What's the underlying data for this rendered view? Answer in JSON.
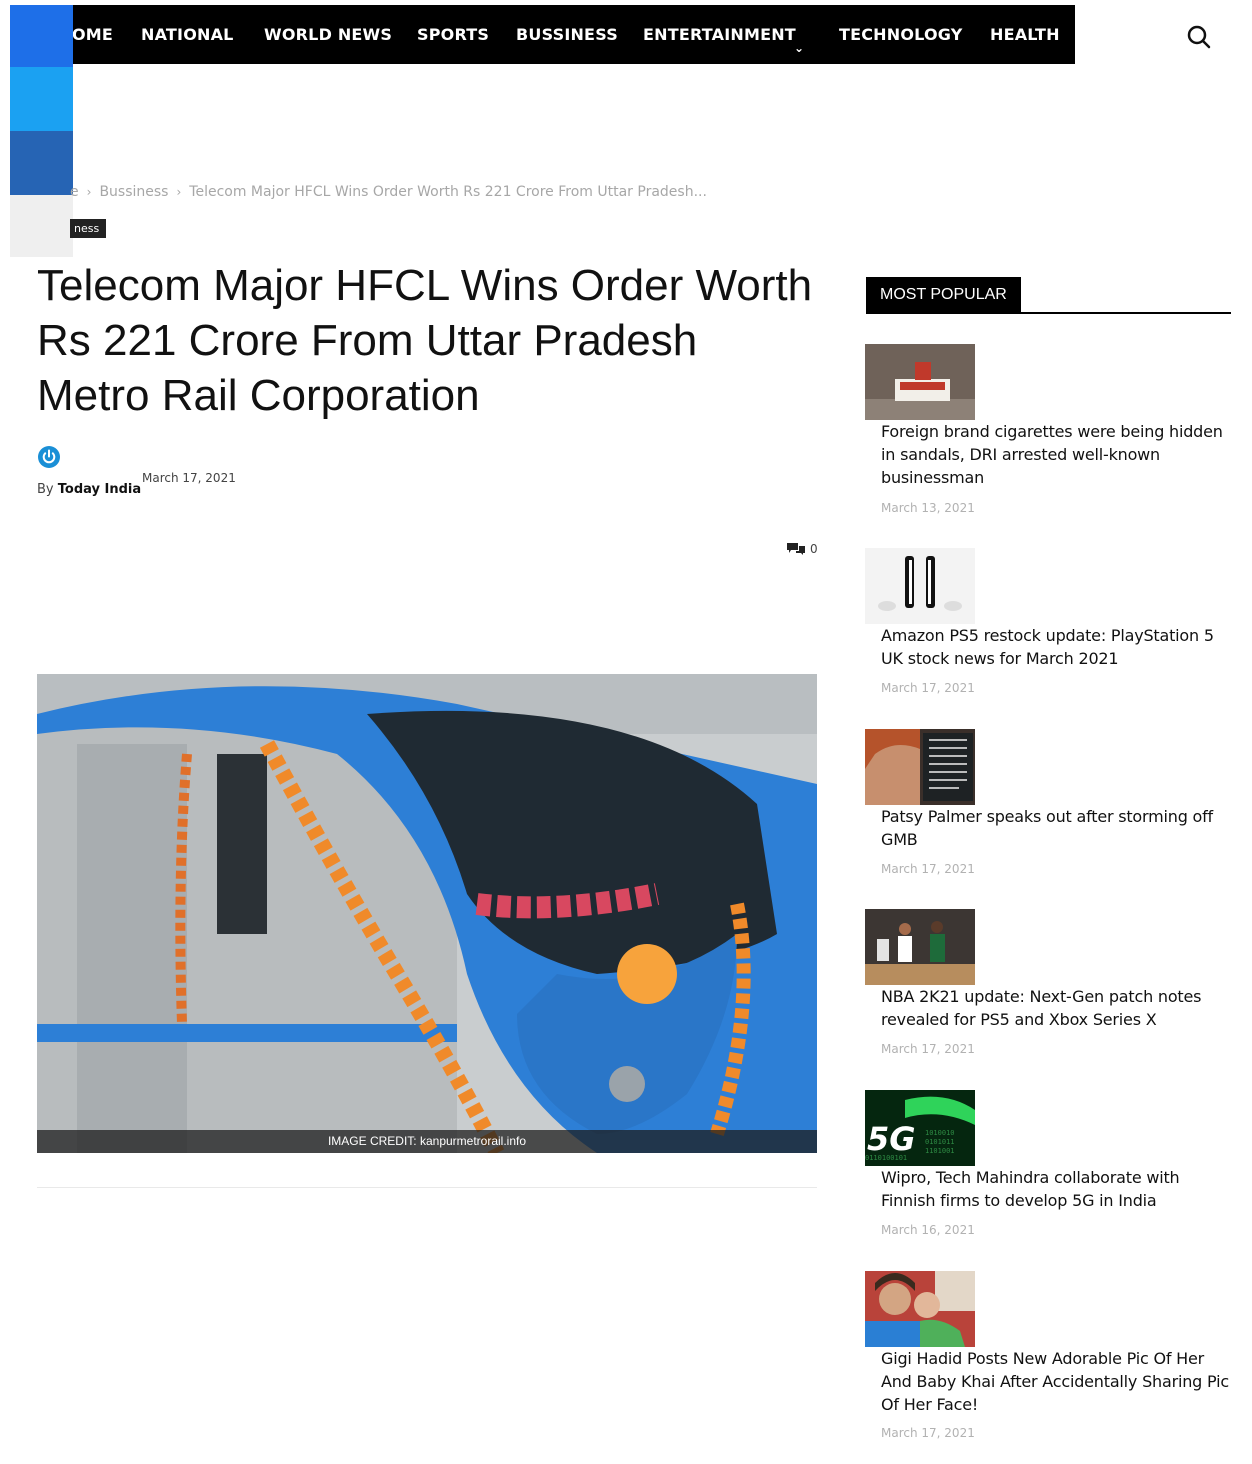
{
  "nav": {
    "items": [
      "OME",
      "NATIONAL",
      "WORLD NEWS",
      "SPORTS",
      "BUSSINESS",
      "ENTERTAINMENT",
      "TECHNOLOGY",
      "HEALTH"
    ]
  },
  "breadcrumb": {
    "home": "e",
    "category": "Bussiness",
    "current": "Telecom Major HFCL Wins Order Worth Rs 221 Crore From Uttar Pradesh..."
  },
  "category_badge": "ness",
  "article": {
    "title": "Telecom Major HFCL Wins Order Worth Rs 221 Crore From Uttar Pradesh Metro Rail Corporation",
    "by_label": "By",
    "author": "Today India",
    "date": "March 17, 2021",
    "comments_count": "0",
    "image_credit": "IMAGE CREDIT: kanpurmetrorail.info"
  },
  "sidebar": {
    "heading": "MOST POPULAR",
    "items": [
      {
        "title": "Foreign brand cigarettes were being hidden in sandals, DRI arrested well-known businessman",
        "date": "March 13, 2021"
      },
      {
        "title": "Amazon PS5 restock update: PlayStation 5 UK stock news for March 2021",
        "date": "March 17, 2021"
      },
      {
        "title": "Patsy Palmer speaks out after storming off GMB",
        "date": "March 17, 2021"
      },
      {
        "title": "NBA 2K21 update: Next-Gen patch notes revealed for PS5 and Xbox Series X",
        "date": "March 17, 2021"
      },
      {
        "title": "Wipro, Tech Mahindra collaborate with Finnish firms to develop 5G in India",
        "date": "March 16, 2021"
      },
      {
        "title": "Gigi Hadid Posts New Adorable Pic Of Her And Baby Khai After Accidentally Sharing Pic Of Her Face!",
        "date": "March 17, 2021"
      }
    ]
  },
  "thumb_5g_text": "5G",
  "colors": {
    "nav_bg": "#000000",
    "share_facebook": "#1e6fe8",
    "share_twitter": "#1ba1f2",
    "share_linkedin": "#2664b4",
    "author_icon": "#1a8fd6",
    "metro_blue": "#2d7fd6"
  }
}
